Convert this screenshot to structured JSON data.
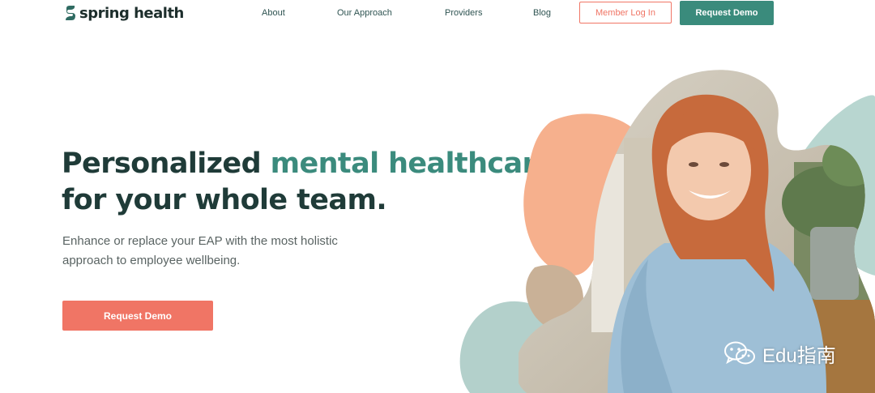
{
  "brand": {
    "name": "spring health",
    "color_primary": "#3a8b7c",
    "color_accent": "#f07565"
  },
  "nav": {
    "links": [
      "About",
      "Our Approach",
      "Providers",
      "Blog"
    ],
    "login_label": "Member Log In",
    "demo_label": "Request Demo"
  },
  "hero": {
    "title_part1": "Personalized ",
    "title_accent": "mental healthcare",
    "title_part2": "for your whole team.",
    "subtitle": "Enhance or replace your EAP with the most holistic approach to employee wellbeing.",
    "cta_label": "Request Demo",
    "image": "smiling-woman-photo"
  },
  "watermark": {
    "icon": "wechat-icon",
    "text": "Edu指南"
  }
}
